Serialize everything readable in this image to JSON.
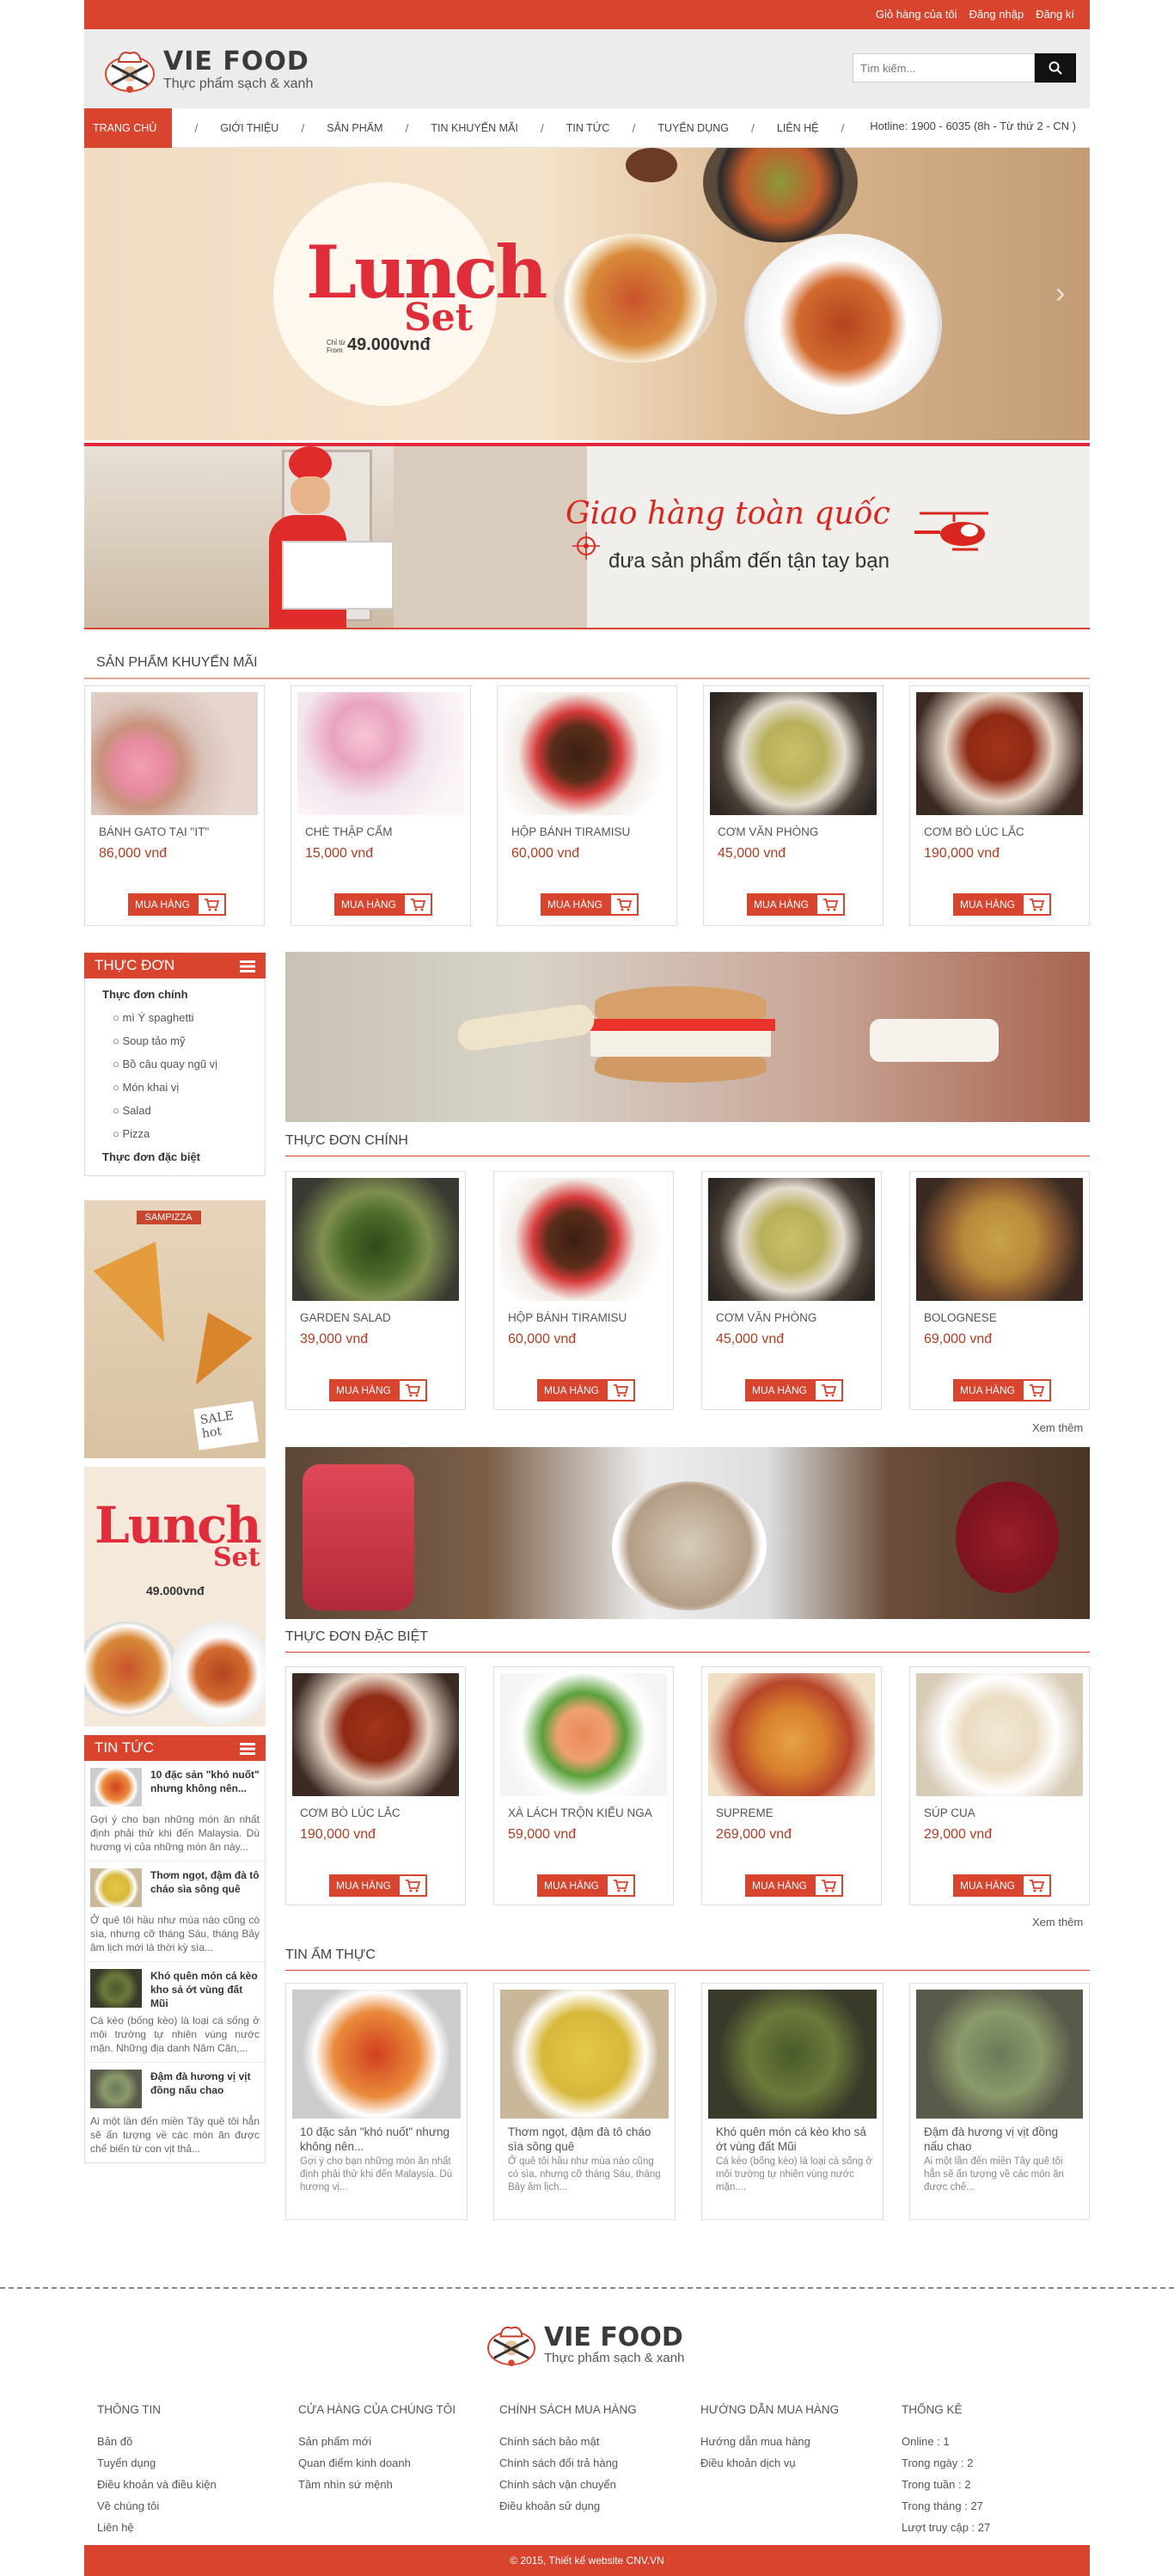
{
  "topbar": {
    "cart": "Giỏ hàng của tôi",
    "login": "Đăng nhập",
    "register": "Đăng kí"
  },
  "brand": {
    "name": "VIE FOOD",
    "tagline": "Thực phẩm sạch & xanh"
  },
  "search": {
    "placeholder": "Tìm kiếm..."
  },
  "nav": {
    "items": [
      "TRANG CHỦ",
      "GIỚI THIỆU",
      "SẢN PHẨM",
      "TIN KHUYẾN MÃI",
      "TIN TỨC",
      "TUYỂN DỤNG",
      "LIÊN HỆ"
    ],
    "hotline": "Hotline: 1900 - 6035 (8h - Từ thứ 2 - CN )"
  },
  "slider": {
    "title1": "Lunch",
    "title2": "Set",
    "from_label1": "Chỉ từ",
    "from_label2": "From",
    "price": "49.000vnđ"
  },
  "shipping": {
    "headline": "Giao hàng toàn quốc",
    "sub": "đưa sản phẩm đến tận tay bạn"
  },
  "buy_label": "MUA HÀNG",
  "colors": {
    "primary": "#d9442f",
    "price": "#b23b20"
  },
  "promo": {
    "title": "SẢN PHẨM KHUYẾN MÃI",
    "items": [
      {
        "name": "BÁNH GATO TẠI \"IT\"",
        "price": "86,000 vnđ"
      },
      {
        "name": "CHÈ THẬP CẨM",
        "price": "15,000 vnđ"
      },
      {
        "name": "HỘP BÁNH TIRAMISU",
        "price": "60,000 vnđ"
      },
      {
        "name": "CƠM VĂN PHÒNG",
        "price": "45,000 vnđ"
      },
      {
        "name": "CƠM BÒ LÚC LẮC",
        "price": "190,000 vnđ"
      }
    ]
  },
  "sidebar": {
    "menu_title": "THỰC ĐƠN",
    "menu": [
      {
        "label": "Thực đơn chính",
        "type": "bold"
      },
      {
        "label": "mì Ý spaghetti",
        "type": "sub"
      },
      {
        "label": "Soup tảo mỹ",
        "type": "sub"
      },
      {
        "label": "Bồ câu quay ngũ vị",
        "type": "sub"
      },
      {
        "label": "Món khai vị",
        "type": "sub"
      },
      {
        "label": "Salad",
        "type": "sub"
      },
      {
        "label": "Pizza",
        "type": "sub"
      },
      {
        "label": "Thực đơn đặc biệt",
        "type": "bold"
      }
    ],
    "ad1": {
      "brand": "SAMPIZZA",
      "badge1": "SALE",
      "badge2": "hot"
    },
    "ad2": {
      "title1": "Lunch",
      "title2": "Set",
      "price": "49.000vnđ"
    },
    "news_title": "TIN TỨC",
    "news": [
      {
        "title": "10 đặc sản \"khó nuốt\" nhưng không nên...",
        "excerpt": "Gợi ý cho bạn những món ăn nhất định phải thử khi đến Malaysia. Dù hương vị của những món ăn này..."
      },
      {
        "title": "Thơm ngọt, đậm đà tô cháo sìa sông quê",
        "excerpt": "Ở quê tôi hầu như mùa nào cũng có sìa, nhưng cỡ tháng Sáu, tháng Bảy âm lịch mới là thời kỳ sìa..."
      },
      {
        "title": "Khó quên món cá kèo kho sả ớt vùng đất Mũi",
        "excerpt": "Cá kèo (bống kèo) là loại cá sống ở môi trường tự nhiên vùng nước mặn. Những địa danh Năm Căn,..."
      },
      {
        "title": "Đậm đà hương vị vịt đồng nấu chao",
        "excerpt": "Ai một lần đến miền Tây quê tôi hẳn sẽ ấn tượng về các món ăn được chế biến từ con vịt thả..."
      }
    ]
  },
  "main_menu": {
    "title": "THỰC ĐƠN CHÍNH",
    "more": "Xem thêm",
    "items": [
      {
        "name": "GARDEN SALAD",
        "price": "39,000 vnđ"
      },
      {
        "name": "HỘP BÁNH TIRAMISU",
        "price": "60,000 vnđ"
      },
      {
        "name": "CƠM VĂN PHÒNG",
        "price": "45,000 vnđ"
      },
      {
        "name": "BOLOGNESE",
        "price": "69,000 vnđ"
      }
    ]
  },
  "special_menu": {
    "title": "THỰC ĐƠN ĐẶC BIỆT",
    "more": "Xem thêm",
    "items": [
      {
        "name": "CƠM BÒ LÚC LẮC",
        "price": "190,000 vnđ"
      },
      {
        "name": "XÀ LÁCH TRỘN KIỂU NGA",
        "price": "59,000 vnđ"
      },
      {
        "name": "SUPREME",
        "price": "269,000 vnđ"
      },
      {
        "name": "SÚP CUA",
        "price": "29,000 vnđ"
      }
    ]
  },
  "food_news": {
    "title": "TIN ẨM THỰC",
    "items": [
      {
        "title": "10 đặc sản \"khó nuốt\" nhưng không nên...",
        "excerpt": "Gợi ý cho bạn những món ăn nhất định phải thử khi đến Malaysia. Dù hương vị..."
      },
      {
        "title": "Thơm ngọt, đậm đà tô cháo sìa sông quê",
        "excerpt": "Ở quê tôi hầu như mùa nào cũng có sìa, nhưng cỡ tháng Sáu, tháng Bảy âm lịch..."
      },
      {
        "title": "Khó quên món cá kèo kho sả ớt vùng đất Mũi",
        "excerpt": "Cá kèo (bống kèo) là loại cá sống ở môi trường tự nhiên vùng nước mặn...."
      },
      {
        "title": "Đậm đà hương vị vịt đồng nấu chao",
        "excerpt": "Ai một lần đến miền Tây quê tôi hẳn sẽ ấn tượng về các món ăn được chế..."
      }
    ]
  },
  "footer": {
    "col1": {
      "title": "THÔNG TIN",
      "links": [
        "Bản đồ",
        "Tuyển dụng",
        "Điều khoản và điều kiện",
        "Về chúng tôi",
        "Liên hệ"
      ]
    },
    "col2": {
      "title": "CỬA HÀNG CỦA CHÚNG TÔI",
      "links": [
        "Sản phẩm mới",
        "Quan điểm kinh doanh",
        "Tầm nhìn sứ mệnh"
      ]
    },
    "col3": {
      "title": "CHÍNH SÁCH MUA HÀNG",
      "links": [
        "Chính sách bảo mật",
        "Chính sách đổi trả hàng",
        "Chính sách vận chuyển",
        "Điều khoản sử dụng"
      ]
    },
    "col4": {
      "title": "HƯỚNG DẪN MUA HÀNG",
      "links": [
        "Hướng dẫn mua hàng",
        "Điều khoản dịch vụ"
      ]
    },
    "col5": {
      "title": "THỐNG KÊ",
      "links": [
        "Online : 1",
        "Trong ngày : 2",
        "Trong tuần : 2",
        "Trong tháng : 27",
        "Lượt truy cập : 27"
      ]
    },
    "copyright": "© 2015, Thiết kế website CNV.VN"
  }
}
